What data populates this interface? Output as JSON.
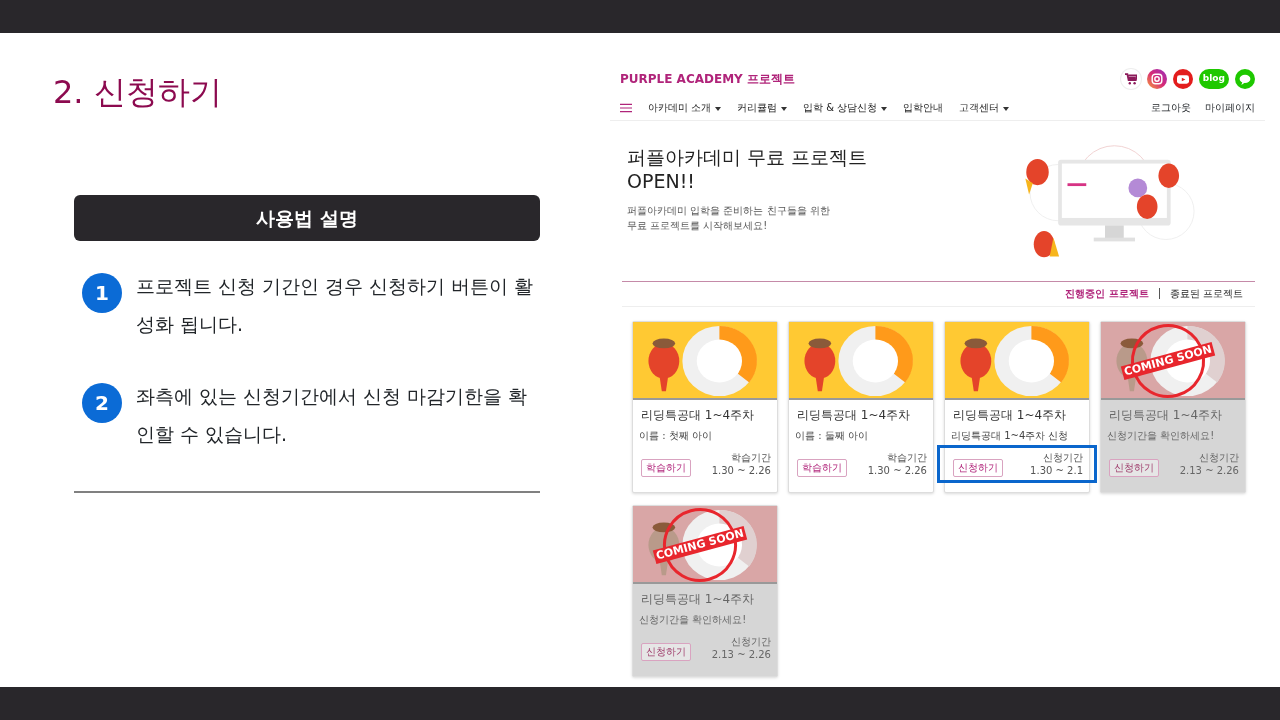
{
  "slide": {
    "title": "2. 신청하기",
    "guide_header": "사용법 설명",
    "steps": [
      {
        "number": "1",
        "text": "프로젝트 신청 기간인 경우 신청하기 버튼이 활성화 됩니다."
      },
      {
        "number": "2",
        "text": "좌측에 있는 신청기간에서 신청 마감기한을 확인할 수 있습니다."
      }
    ]
  },
  "site": {
    "brand": "PURPLE ACADEMY 프로젝트",
    "social": [
      {
        "kind": "cart"
      },
      {
        "kind": "instagram"
      },
      {
        "kind": "youtube"
      },
      {
        "kind": "blog",
        "label": "blog"
      },
      {
        "kind": "talk"
      }
    ],
    "nav": [
      {
        "label": "아카데미 소개",
        "dropdown": true
      },
      {
        "label": "커리큘럼",
        "dropdown": true
      },
      {
        "label": "입학 & 상담신청",
        "dropdown": true
      },
      {
        "label": "입학안내",
        "dropdown": false
      },
      {
        "label": "고객센터",
        "dropdown": true
      }
    ],
    "user_links": [
      "로그아웃",
      "마이페이지"
    ],
    "hero": {
      "title": "퍼플아카데미 무료 프로젝트\nOPEN!!",
      "text": "퍼플아카데미 입학을 준비하는 친구들을 위한\n무료 프로젝트를 시작해보세요!"
    },
    "tabs": [
      {
        "label": "진행중인 프로젝트",
        "selected": true
      },
      {
        "label": "종료된 프로젝트",
        "selected": false
      }
    ],
    "cards": [
      {
        "kind": "open",
        "title": "리딩특공대 1~4주차",
        "subtitle": "이름 : 첫째 아이",
        "button": "학습하기",
        "period_label": "학습기간",
        "period": "1.30 ~ 2.26",
        "highlighted": false
      },
      {
        "kind": "open",
        "title": "리딩특공대 1~4주차",
        "subtitle": "이름 : 둘째 아이",
        "button": "학습하기",
        "period_label": "학습기간",
        "period": "1.30 ~ 2.26",
        "highlighted": false
      },
      {
        "kind": "open",
        "title": "리딩특공대 1~4주차",
        "subtitle": "리딩특공대 1~4주차 신청",
        "button": "신청하기",
        "period_label": "신청기간",
        "period": "1.30 ~ 2.1",
        "highlighted": true
      },
      {
        "kind": "coming_soon",
        "stamp": "COMING SOON",
        "title": "리딩특공대 1~4주차",
        "subtitle": "신청기간을 확인하세요!",
        "button": "신청하기",
        "period_label": "신청기간",
        "period": "2.13 ~ 2.26",
        "highlighted": false
      },
      {
        "kind": "coming_soon",
        "stamp": "COMING SOON",
        "title": "리딩특공대 1~4주차",
        "subtitle": "신청기간을 확인하세요!",
        "button": "신청하기",
        "period_label": "신청기간",
        "period": "2.13 ~ 2.26",
        "highlighted": false
      }
    ]
  }
}
